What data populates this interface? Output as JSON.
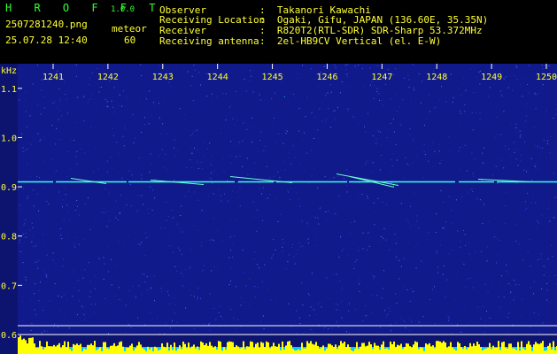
{
  "header": {
    "app_name": "H R O F F T",
    "version": "1.0.0",
    "file_name": "2507281240.png",
    "mode": "meteor",
    "timestamp": "25.07.28 12:40",
    "count": "60",
    "fields": [
      {
        "label": "Observer",
        "value": ":  Takanori Kawachi"
      },
      {
        "label": "Receiving Location",
        "value": ":  Ogaki, Gifu, JAPAN (136.60E, 35.35N)"
      },
      {
        "label": "Receiver",
        "value": ":  R820T2(RTL-SDR) SDR-Sharp 53.372MHz"
      },
      {
        "label": "Receiving antenna",
        "value": ":  2el-HB9CV Vertical (el. E-W)"
      }
    ]
  },
  "chart_data": {
    "type": "heatmap",
    "y_unit": "kHz",
    "x_ticks": [
      "1241",
      "1242",
      "1243",
      "1244",
      "1245",
      "1246",
      "1247",
      "1248",
      "1249",
      "1250"
    ],
    "y_ticks": [
      "1.1",
      "1.0",
      "0.9",
      "0.8",
      "0.7",
      "0.6"
    ],
    "y_range": [
      0.6,
      1.15
    ],
    "carrier_khz": 0.91,
    "colors": {
      "background": "#101a8a",
      "grid": "#ffffff",
      "tick_text": "#ffff33",
      "trace": "#33ffee",
      "bars": "#ffff00",
      "baseline": "#00ccff"
    }
  }
}
